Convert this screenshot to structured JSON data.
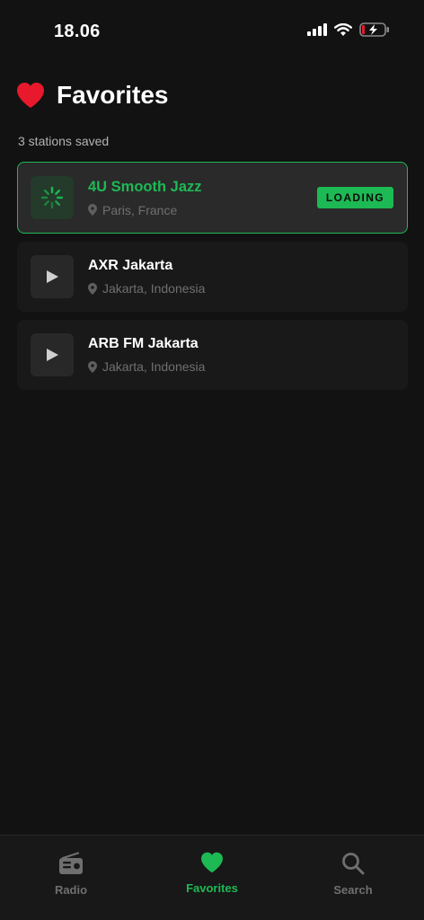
{
  "status_bar": {
    "time": "18.06"
  },
  "header": {
    "title": "Favorites",
    "subtitle": "3 stations saved"
  },
  "stations": [
    {
      "name": "4U Smooth Jazz",
      "location": "Paris, France",
      "state": "LOADING"
    },
    {
      "name": "AXR Jakarta",
      "location": "Jakarta, Indonesia"
    },
    {
      "name": "ARB FM Jakarta",
      "location": "Jakarta, Indonesia"
    }
  ],
  "tabs": [
    {
      "label": "Radio",
      "icon": "radio-icon"
    },
    {
      "label": "Favorites",
      "icon": "heart-icon",
      "active": true
    },
    {
      "label": "Search",
      "icon": "search-icon"
    }
  ],
  "colors": {
    "accent": "#1db954",
    "heart": "#e8192c",
    "background": "#121212"
  }
}
